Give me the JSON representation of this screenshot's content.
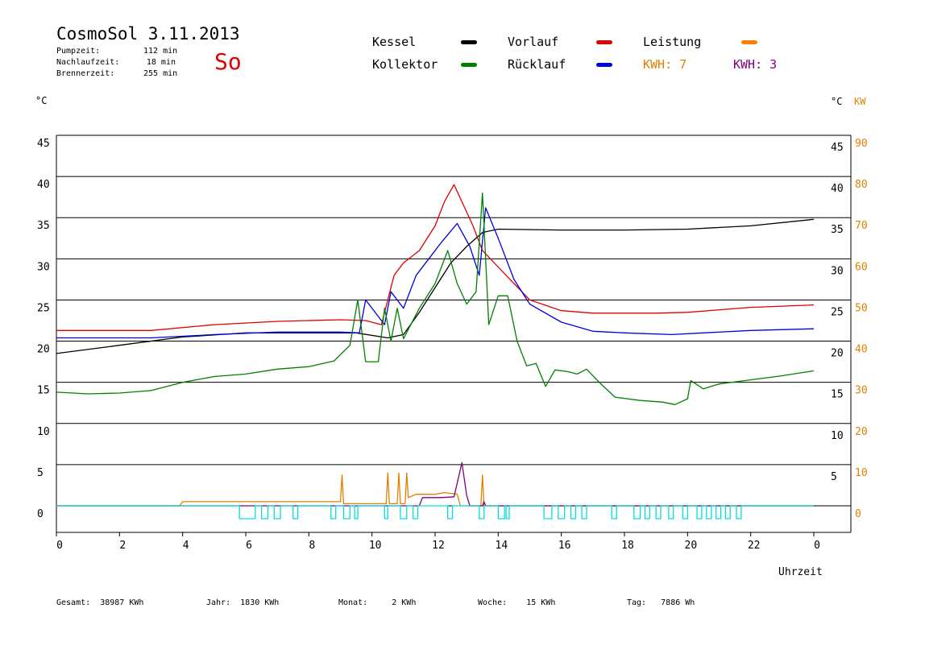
{
  "header": {
    "title": "CosmoSol 3.11.2013",
    "day": "So",
    "info": [
      {
        "label": "Pumpzeit:",
        "value": "112 min"
      },
      {
        "label": "Nachlaufzeit:",
        "value": "18 min"
      },
      {
        "label": "Brennerzeit:",
        "value": "255 min"
      }
    ]
  },
  "legend": {
    "items": [
      {
        "label": "Kessel",
        "color": "#000000"
      },
      {
        "label": "Vorlauf",
        "color": "#e00000"
      },
      {
        "label": "Leistung",
        "color": "#ff8000"
      },
      {
        "label": "Kollektor",
        "color": "#008000"
      },
      {
        "label": "Rücklauf",
        "color": "#0000e0"
      }
    ],
    "kwh": [
      {
        "label": "KWH:",
        "value": "7",
        "color": "#e08000"
      },
      {
        "label": "KWH:",
        "value": "3",
        "color": "#800080"
      }
    ]
  },
  "axis_units": {
    "left": "°C",
    "right": "°C",
    "right2": "KW"
  },
  "xlabel": "Uhrzeit",
  "footer": [
    {
      "label": "Gesamt:",
      "value": "38987 KWh"
    },
    {
      "label": "Jahr:",
      "value": "1830 KWh"
    },
    {
      "label": "Monat:",
      "value": "2 KWh"
    },
    {
      "label": "Woche:",
      "value": "15 KWh"
    },
    {
      "label": "Tag:",
      "value": "7886 Wh"
    }
  ],
  "chart_data": {
    "type": "line",
    "title": "CosmoSol 3.11.2013",
    "xlabel": "Uhrzeit",
    "ylabel": "°C",
    "y2label": "KW",
    "xlim": [
      0,
      24
    ],
    "ylim": [
      0,
      45
    ],
    "y2lim": [
      0,
      90
    ],
    "x_ticks": [
      "0",
      "2",
      "4",
      "6",
      "8",
      "10",
      "12",
      "14",
      "16",
      "18",
      "20",
      "22",
      "0"
    ],
    "y_ticks": [
      0,
      5,
      10,
      15,
      20,
      25,
      30,
      35,
      40,
      45
    ],
    "y_ticks_right": [
      5,
      10,
      15,
      20,
      25,
      30,
      35,
      40,
      45
    ],
    "y2_ticks": [
      0,
      10,
      20,
      30,
      40,
      50,
      60,
      70,
      80,
      90
    ],
    "grid": "horizontal",
    "series": [
      {
        "name": "Kessel",
        "color": "#000000",
        "points": [
          [
            0,
            18.5
          ],
          [
            2,
            19.5
          ],
          [
            4,
            20.5
          ],
          [
            6,
            21
          ],
          [
            8,
            21
          ],
          [
            9.5,
            21
          ],
          [
            10.5,
            20.4
          ],
          [
            11,
            20.8
          ],
          [
            11.5,
            23.5
          ],
          [
            12,
            26.5
          ],
          [
            12.5,
            29.5
          ],
          [
            13,
            31.5
          ],
          [
            13.5,
            33.2
          ],
          [
            14,
            33.6
          ],
          [
            16,
            33.5
          ],
          [
            18,
            33.5
          ],
          [
            20,
            33.6
          ],
          [
            22,
            34
          ],
          [
            24,
            34.8
          ]
        ]
      },
      {
        "name": "Vorlauf",
        "color": "#e00000",
        "points": [
          [
            0,
            21.3
          ],
          [
            3,
            21.3
          ],
          [
            5,
            22
          ],
          [
            7,
            22.4
          ],
          [
            9,
            22.6
          ],
          [
            9.8,
            22.5
          ],
          [
            10.3,
            22
          ],
          [
            10.7,
            28
          ],
          [
            11,
            29.5
          ],
          [
            11.5,
            31
          ],
          [
            12,
            34
          ],
          [
            12.3,
            37
          ],
          [
            12.6,
            39
          ],
          [
            12.9,
            36.5
          ],
          [
            13.2,
            34
          ],
          [
            13.5,
            31
          ],
          [
            14,
            29
          ],
          [
            14.5,
            27
          ],
          [
            15,
            25
          ],
          [
            16,
            23.7
          ],
          [
            17,
            23.4
          ],
          [
            18,
            23.4
          ],
          [
            19,
            23.4
          ],
          [
            20,
            23.5
          ],
          [
            22,
            24.1
          ],
          [
            24,
            24.4
          ]
        ]
      },
      {
        "name": "Rücklauf",
        "color": "#0000e0",
        "points": [
          [
            0,
            20.4
          ],
          [
            3,
            20.4
          ],
          [
            5,
            20.8
          ],
          [
            7,
            21.1
          ],
          [
            9,
            21.1
          ],
          [
            9.6,
            21
          ],
          [
            9.8,
            25
          ],
          [
            10.4,
            22
          ],
          [
            10.6,
            26
          ],
          [
            11,
            24
          ],
          [
            11.4,
            28
          ],
          [
            11.8,
            30
          ],
          [
            12.2,
            32
          ],
          [
            12.7,
            34.3
          ],
          [
            13.1,
            31.5
          ],
          [
            13.4,
            28
          ],
          [
            13.6,
            36.2
          ],
          [
            14,
            32.5
          ],
          [
            14.5,
            27.5
          ],
          [
            15,
            24.5
          ],
          [
            16,
            22.3
          ],
          [
            17,
            21.2
          ],
          [
            18,
            21
          ],
          [
            19.5,
            20.8
          ],
          [
            20.5,
            21
          ],
          [
            22,
            21.3
          ],
          [
            24,
            21.5
          ]
        ]
      },
      {
        "name": "Kollektor",
        "color": "#008000",
        "points": [
          [
            0,
            13.8
          ],
          [
            1,
            13.6
          ],
          [
            2,
            13.7
          ],
          [
            3,
            14
          ],
          [
            4,
            15
          ],
          [
            5,
            15.7
          ],
          [
            6,
            16
          ],
          [
            7,
            16.6
          ],
          [
            8,
            16.9
          ],
          [
            8.8,
            17.6
          ],
          [
            9.3,
            19.5
          ],
          [
            9.55,
            25
          ],
          [
            9.8,
            17.5
          ],
          [
            10.2,
            17.5
          ],
          [
            10.4,
            24
          ],
          [
            10.6,
            20
          ],
          [
            10.8,
            24
          ],
          [
            11,
            20.3
          ],
          [
            11.5,
            24
          ],
          [
            12,
            27
          ],
          [
            12.4,
            31
          ],
          [
            12.7,
            27
          ],
          [
            13,
            24.5
          ],
          [
            13.3,
            26
          ],
          [
            13.5,
            38
          ],
          [
            13.7,
            22
          ],
          [
            14,
            25.5
          ],
          [
            14.3,
            25.5
          ],
          [
            14.6,
            20
          ],
          [
            14.9,
            17
          ],
          [
            15.2,
            17.3
          ],
          [
            15.5,
            14.5
          ],
          [
            15.8,
            16.5
          ],
          [
            16.2,
            16.3
          ],
          [
            16.5,
            16
          ],
          [
            16.8,
            16.6
          ],
          [
            17.2,
            15
          ],
          [
            17.7,
            13.2
          ],
          [
            18.5,
            12.8
          ],
          [
            19.2,
            12.6
          ],
          [
            19.6,
            12.3
          ],
          [
            20,
            13
          ],
          [
            20.1,
            15.2
          ],
          [
            20.5,
            14.2
          ],
          [
            21,
            14.8
          ],
          [
            22,
            15.3
          ],
          [
            23,
            15.8
          ],
          [
            24,
            16.4
          ]
        ]
      },
      {
        "name": "Leistung",
        "color": "#e08000",
        "unit": "KW",
        "points": [
          [
            0,
            0
          ],
          [
            3.9,
            0
          ],
          [
            4.0,
            1.0
          ],
          [
            9.0,
            1.0
          ],
          [
            9.05,
            7.5
          ],
          [
            9.1,
            0.5
          ],
          [
            10.45,
            0.5
          ],
          [
            10.5,
            8
          ],
          [
            10.55,
            0.5
          ],
          [
            10.8,
            0.5
          ],
          [
            10.85,
            8
          ],
          [
            10.9,
            0.5
          ],
          [
            11.05,
            0.5
          ],
          [
            11.1,
            8
          ],
          [
            11.15,
            2
          ],
          [
            11.4,
            2.8
          ],
          [
            12.0,
            2.8
          ],
          [
            12.3,
            3.2
          ],
          [
            12.7,
            2.8
          ],
          [
            12.8,
            0
          ],
          [
            13.45,
            0
          ],
          [
            13.5,
            7.5
          ],
          [
            13.55,
            0
          ],
          [
            24,
            0
          ]
        ]
      },
      {
        "name": "Leistung 2",
        "color": "#800080",
        "unit": "KW",
        "points": [
          [
            0,
            0
          ],
          [
            11.5,
            0
          ],
          [
            11.6,
            2
          ],
          [
            12.2,
            2
          ],
          [
            12.6,
            2.2
          ],
          [
            12.85,
            10.5
          ],
          [
            13.0,
            2.5
          ],
          [
            13.1,
            0
          ],
          [
            13.5,
            0
          ],
          [
            13.55,
            1
          ],
          [
            13.6,
            0
          ],
          [
            24,
            0
          ]
        ]
      }
    ],
    "pump": {
      "color": "#00e0e0",
      "on_intervals": [
        [
          5.8,
          6.3
        ],
        [
          6.5,
          6.7
        ],
        [
          6.9,
          7.1
        ],
        [
          7.5,
          7.65
        ],
        [
          8.7,
          8.85
        ],
        [
          9.1,
          9.3
        ],
        [
          9.45,
          9.55
        ],
        [
          10.4,
          10.5
        ],
        [
          10.9,
          11.1
        ],
        [
          11.3,
          11.45
        ],
        [
          12.4,
          12.55
        ],
        [
          13.4,
          13.55
        ],
        [
          14.0,
          14.2
        ],
        [
          14.25,
          14.35
        ],
        [
          15.45,
          15.7
        ],
        [
          15.9,
          16.1
        ],
        [
          16.3,
          16.45
        ],
        [
          16.65,
          16.8
        ],
        [
          17.6,
          17.75
        ],
        [
          18.3,
          18.5
        ],
        [
          18.65,
          18.8
        ],
        [
          19.0,
          19.15
        ],
        [
          19.4,
          19.55
        ],
        [
          19.85,
          20.0
        ],
        [
          20.3,
          20.45
        ],
        [
          20.6,
          20.75
        ],
        [
          20.9,
          21.05
        ],
        [
          21.2,
          21.35
        ],
        [
          21.55,
          21.7
        ]
      ]
    }
  }
}
